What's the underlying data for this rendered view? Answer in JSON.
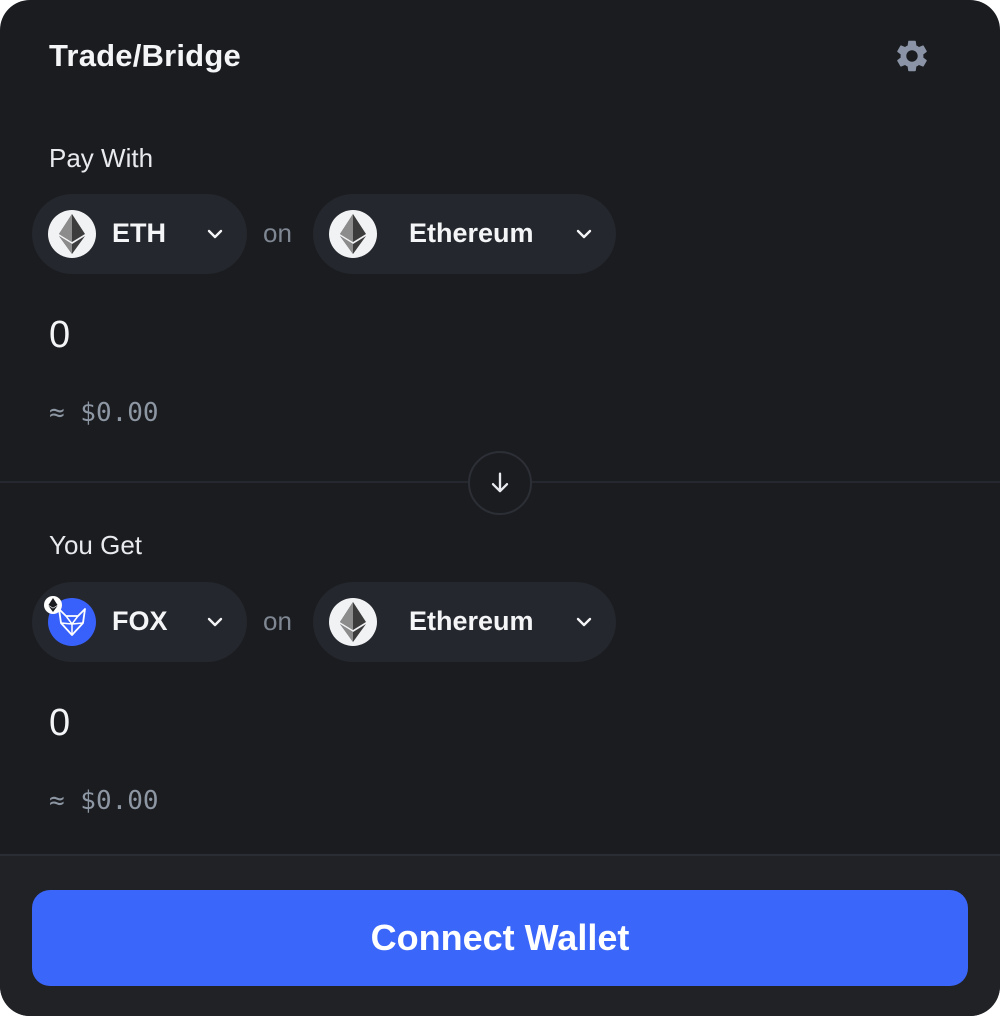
{
  "header": {
    "title": "Trade/Bridge",
    "settings_icon": "gear-icon"
  },
  "pay": {
    "label": "Pay With",
    "asset": {
      "symbol": "ETH",
      "icon": "ethereum-icon"
    },
    "on_text": "on",
    "chain": {
      "name": "Ethereum",
      "icon": "ethereum-icon"
    },
    "amount": "0",
    "fiat": "≈ $0.00"
  },
  "swap_icon": "arrow-down-icon",
  "get": {
    "label": "You Get",
    "asset": {
      "symbol": "FOX",
      "icon": "fox-icon"
    },
    "on_text": "on",
    "chain": {
      "name": "Ethereum",
      "icon": "ethereum-icon"
    },
    "amount": "0",
    "fiat": "≈ $0.00"
  },
  "footer": {
    "connect_label": "Connect Wallet"
  },
  "colors": {
    "background": "#1b1c20",
    "pill": "#24272d",
    "accent": "#3a66f9",
    "muted": "#8d96a3"
  }
}
